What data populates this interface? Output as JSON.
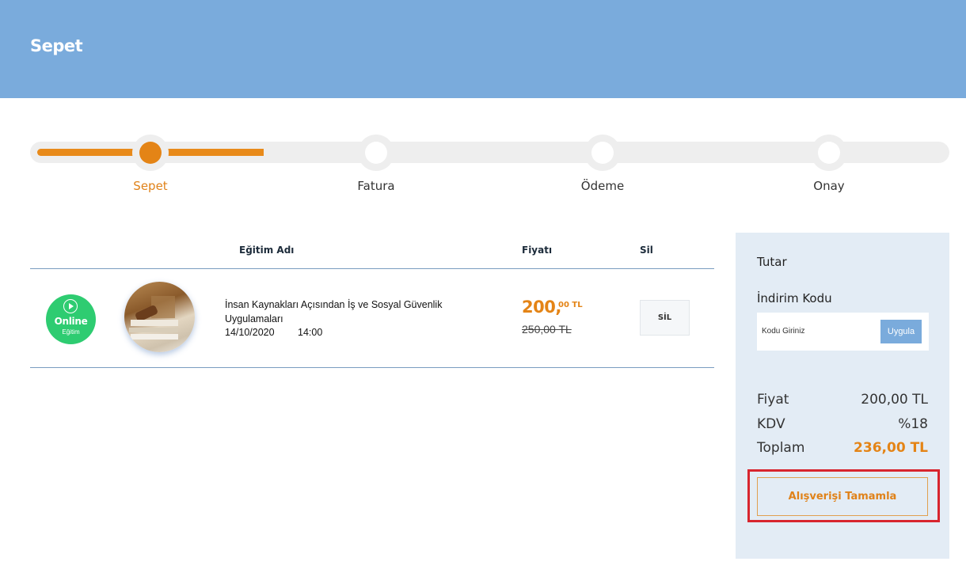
{
  "header": {
    "title": "Sepet"
  },
  "steps": [
    {
      "label": "Sepet",
      "active": true
    },
    {
      "label": "Fatura",
      "active": false
    },
    {
      "label": "Ödeme",
      "active": false
    },
    {
      "label": "Onay",
      "active": false
    }
  ],
  "table": {
    "columns": {
      "name": "Eğitim Adı",
      "price": "Fiyatı",
      "delete": "Sil"
    },
    "rows": [
      {
        "badge_title": "Online",
        "badge_sub": "Eğitim",
        "name": "İnsan Kaynakları Açısından İş ve Sosyal Güvenlik Uygulamaları",
        "date": "14/10/2020",
        "time": "14:00",
        "price_main": "200,",
        "price_sup": "00 TL",
        "price_old": "250,00 TL",
        "delete_label": "SİL"
      }
    ]
  },
  "summary": {
    "title": "Tutar",
    "discount_label": "İndirim Kodu",
    "coupon_placeholder": "Kodu Giriniz",
    "apply_label": "Uygula",
    "price_label": "Fiyat",
    "price_value": "200,00 TL",
    "tax_label": "KDV",
    "tax_value": "%18",
    "total_label": "Toplam",
    "total_value": "236,00 TL",
    "checkout_label": "Alışverişi Tamamla"
  },
  "colors": {
    "header": "#7aabdc",
    "accent": "#e48416",
    "badge": "#2ecc71",
    "highlight": "#d8252e"
  }
}
